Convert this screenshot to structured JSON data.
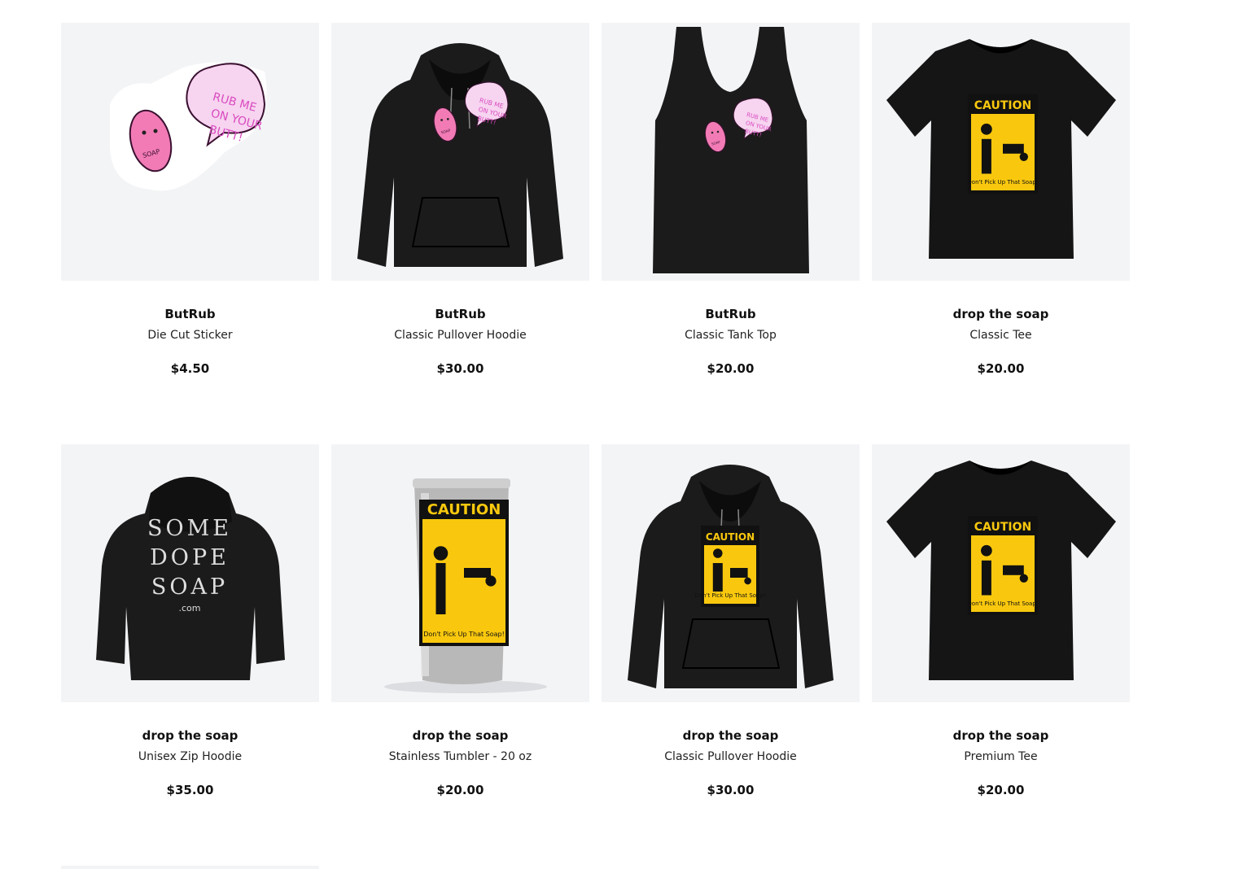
{
  "products": [
    {
      "title": "ButRub",
      "type": "Die Cut Sticker",
      "price": "$4.50",
      "image": "sticker",
      "art": "soap-character",
      "bubble_text": [
        "RUB ME",
        "ON YOUR",
        "BUTT!"
      ],
      "soap_label": "SOAP",
      "color": "#f0f0f0"
    },
    {
      "title": "ButRub",
      "type": "Classic Pullover Hoodie",
      "price": "$30.00",
      "image": "hoodie",
      "art": "soap-character",
      "bubble_text": [
        "RUB ME",
        "ON YOUR",
        "BUTT!"
      ],
      "soap_label": "SOAP",
      "color": "#1b1b1b"
    },
    {
      "title": "ButRub",
      "type": "Classic Tank Top",
      "price": "$20.00",
      "image": "tank",
      "art": "soap-character",
      "bubble_text": [
        "RUB ME",
        "ON YOUR",
        "BUTT!"
      ],
      "soap_label": "SOAP",
      "color": "#1b1b1b"
    },
    {
      "title": "drop the soap",
      "type": "Classic Tee",
      "price": "$20.00",
      "image": "tee",
      "art": "caution-sign",
      "sign_title": "CAUTION",
      "sign_caption": "Don't Pick Up That Soap!",
      "color": "#151515"
    },
    {
      "title": "drop the soap",
      "type": "Unisex Zip Hoodie",
      "price": "$35.00",
      "image": "hoodie-back",
      "art": "text-art",
      "text_lines": [
        "SOME",
        "DOPE",
        "SOAP"
      ],
      "text_sub": ".com",
      "color": "#1b1b1b"
    },
    {
      "title": "drop the soap",
      "type": "Stainless Tumbler - 20 oz",
      "price": "$20.00",
      "image": "tumbler",
      "art": "caution-sign",
      "sign_title": "CAUTION",
      "sign_caption": "Don't Pick Up That Soap!",
      "color": "#b8b8b8"
    },
    {
      "title": "drop the soap",
      "type": "Classic Pullover Hoodie",
      "price": "$30.00",
      "image": "hoodie",
      "art": "caution-sign",
      "sign_title": "CAUTION",
      "sign_caption": "Don't Pick Up That Soap!",
      "color": "#1b1b1b"
    },
    {
      "title": "drop the soap",
      "type": "Premium Tee",
      "price": "$20.00",
      "image": "tee",
      "art": "caution-sign",
      "sign_title": "CAUTION",
      "sign_caption": "Don't Pick Up That Soap!",
      "color": "#151515"
    }
  ],
  "colors": {
    "thumb_bg": "#f3f4f6",
    "caution_yellow": "#f9c80e",
    "pink": "#f27bb5",
    "bubble": "#f7d4f0"
  }
}
